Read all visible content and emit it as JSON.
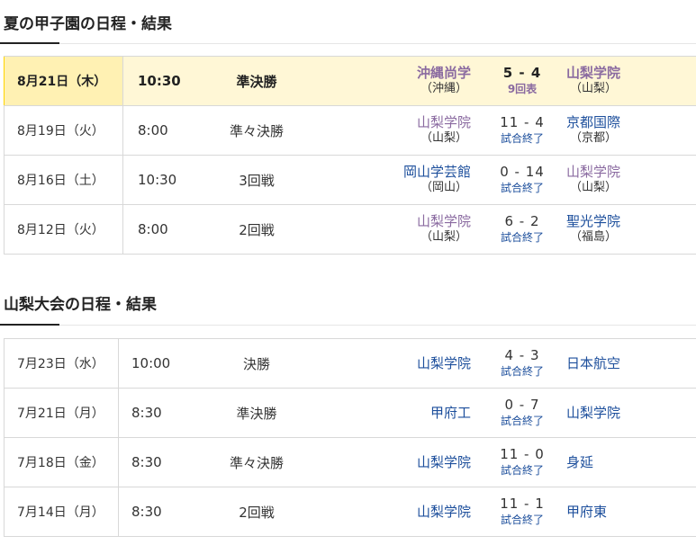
{
  "koshien": {
    "title": "夏の甲子園の日程・結果",
    "games": [
      {
        "date": "8月21日（木）",
        "time": "10:30",
        "round": "準決勝",
        "left": "沖縄尚学",
        "left_pref": "（沖縄）",
        "score": "5 - 4",
        "status": "9回表",
        "right": "山梨学院",
        "right_pref": "（山梨）",
        "left_home": false,
        "right_home": true,
        "highlight": true
      },
      {
        "date": "8月19日（火）",
        "time": "8:00",
        "round": "準々決勝",
        "left": "山梨学院",
        "left_pref": "（山梨）",
        "score": "11 - 4",
        "status": "試合終了",
        "right": "京都国際",
        "right_pref": "（京都）",
        "left_home": true,
        "right_home": false,
        "highlight": false
      },
      {
        "date": "8月16日（土）",
        "time": "10:30",
        "round": "3回戦",
        "left": "岡山学芸館",
        "left_pref": "（岡山）",
        "score": "0 - 14",
        "status": "試合終了",
        "right": "山梨学院",
        "right_pref": "（山梨）",
        "left_home": false,
        "right_home": true,
        "highlight": false
      },
      {
        "date": "8月12日（火）",
        "time": "8:00",
        "round": "2回戦",
        "left": "山梨学院",
        "left_pref": "（山梨）",
        "score": "6 - 2",
        "status": "試合終了",
        "right": "聖光学院",
        "right_pref": "（福島）",
        "left_home": true,
        "right_home": false,
        "highlight": false
      }
    ]
  },
  "yamanashi": {
    "title": "山梨大会の日程・結果",
    "games": [
      {
        "date": "7月23日（水）",
        "time": "10:00",
        "round": "決勝",
        "left": "山梨学院",
        "score": "4 - 3",
        "status": "試合終了",
        "right": "日本航空"
      },
      {
        "date": "7月21日（月）",
        "time": "8:30",
        "round": "準決勝",
        "left": "甲府工",
        "score": "0 - 7",
        "status": "試合終了",
        "right": "山梨学院"
      },
      {
        "date": "7月18日（金）",
        "time": "8:30",
        "round": "準々決勝",
        "left": "山梨学院",
        "score": "11 - 0",
        "status": "試合終了",
        "right": "身延"
      },
      {
        "date": "7月14日（月）",
        "time": "8:30",
        "round": "2回戦",
        "left": "山梨学院",
        "score": "11 - 1",
        "status": "試合終了",
        "right": "甲府東"
      }
    ]
  },
  "colors": {
    "home_team": "#8a6aa0",
    "opponent": "#1d4f9c",
    "highlight_bg": "#fff7d6",
    "highlight_bar": "#ffd400"
  }
}
